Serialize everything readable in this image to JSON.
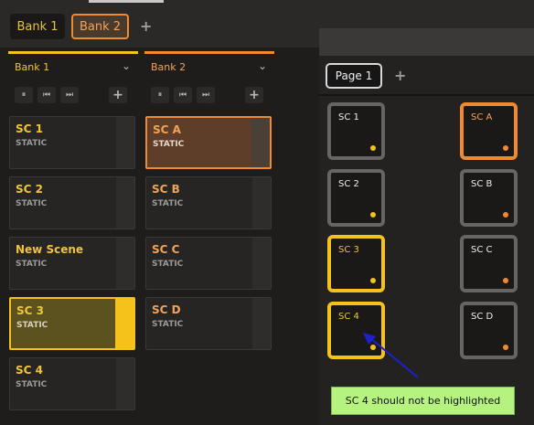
{
  "tabs": {
    "bank1": "Bank 1",
    "bank2": "Bank 2",
    "add": "+"
  },
  "columns": [
    {
      "label": "Bank 1",
      "chevron": "⌄"
    },
    {
      "label": "Bank 2",
      "chevron": "⌄"
    }
  ],
  "controls": {
    "pause": "⏸",
    "prev": "⏮",
    "next": "⏭",
    "add": "+"
  },
  "bank1": [
    {
      "name": "SC 1",
      "status": "STATIC"
    },
    {
      "name": "SC 2",
      "status": "STATIC"
    },
    {
      "name": "New Scene",
      "status": "STATIC"
    },
    {
      "name": "SC 3",
      "status": "STATIC"
    },
    {
      "name": "SC 4",
      "status": "STATIC"
    }
  ],
  "bank2": [
    {
      "name": "SC A",
      "status": "STATIC"
    },
    {
      "name": "SC B",
      "status": "STATIC"
    },
    {
      "name": "SC C",
      "status": "STATIC"
    },
    {
      "name": "SC D",
      "status": "STATIC"
    }
  ],
  "right_panel": {
    "page_tab": "Page 1",
    "add": "+",
    "pads_left": [
      "SC 1",
      "SC 2",
      "SC 3",
      "SC 4"
    ],
    "pads_right": [
      "SC A",
      "SC B",
      "SC C",
      "SC D"
    ]
  },
  "annotation": {
    "note": "SC 4 should not be highlighted",
    "arrow_color": "#1f1fd0"
  },
  "colors": {
    "yellow": "#f4c21b",
    "orange": "#f08a30",
    "note_bg": "#b6f27f"
  }
}
